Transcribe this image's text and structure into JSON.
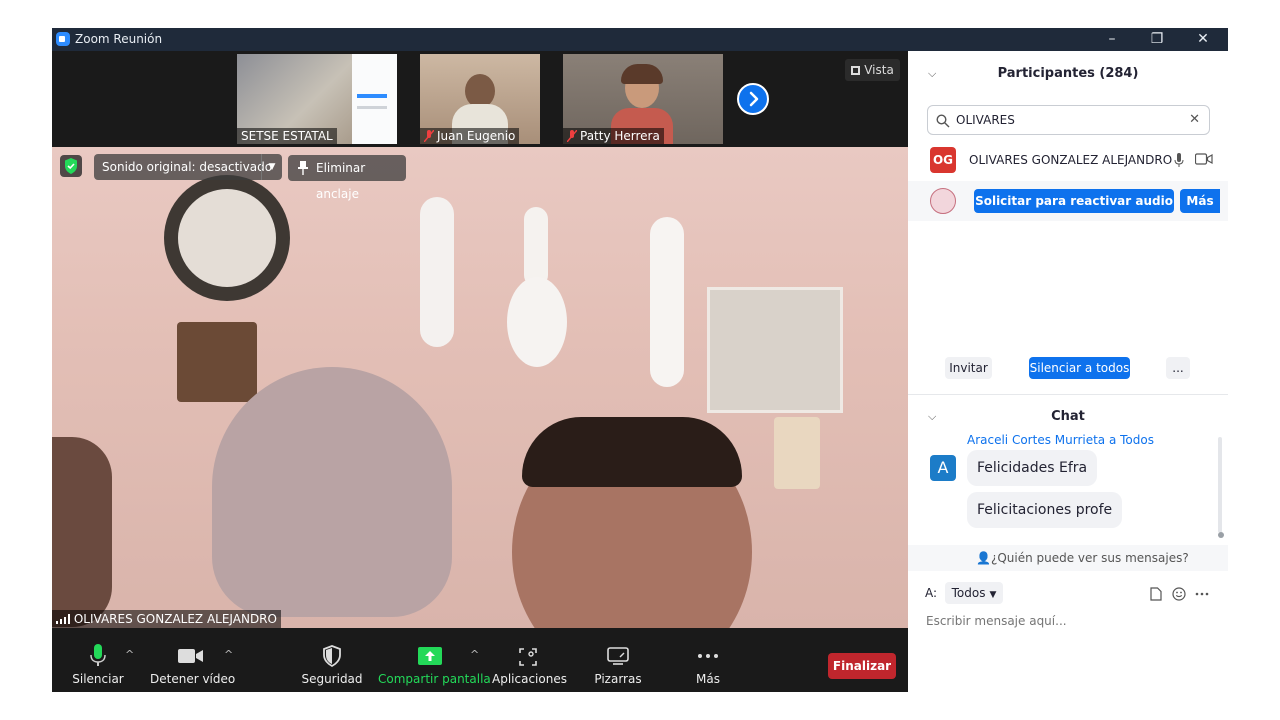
{
  "window": {
    "title": "Zoom Reunión",
    "controls": [
      "–",
      "❐",
      "✕"
    ]
  },
  "thumbnails": [
    {
      "name": "SETSE ESTATAL",
      "muted": false
    },
    {
      "name": "Juan Eugenio",
      "muted": true
    },
    {
      "name": "Patty Herrera",
      "muted": true
    }
  ],
  "view_button": "Vista",
  "main_video": {
    "audio_dropdown": "Sonido original: desactivado",
    "unpin_button": "Eliminar anclaje",
    "speaker_name": "OLIVARES GONZALEZ ALEJANDRO"
  },
  "toolbar": {
    "mute": "Silenciar",
    "stop_video": "Detener vídeo",
    "security": "Seguridad",
    "share_screen": "Compartir pantalla",
    "apps": "Aplicaciones",
    "whiteboards": "Pizarras",
    "more": "Más",
    "end": "Finalizar"
  },
  "participants": {
    "title": "Participantes (284)",
    "search_value": "OLIVARES",
    "list": [
      {
        "initials": "OG",
        "name": "OLIVARES GONZALEZ ALEJANDRO",
        "avatar_color": "#d9362f"
      }
    ],
    "hover_row": {
      "ask_unmute": "Solicitar para reactivar audio",
      "more": "Más"
    },
    "invite": "Invitar",
    "mute_all": "Silenciar a todos",
    "more_dots": "..."
  },
  "chat": {
    "title": "Chat",
    "sender_line": "Araceli Cortes Murrieta a Todos",
    "sender_initial": "A",
    "messages": [
      "Felicidades Efra",
      "Felicitaciones profe"
    ],
    "who_can_see": "¿Quién puede ver sus mensajes?",
    "to_label": "A:",
    "to_value": "Todos",
    "placeholder": "Escribir mensaje aquí..."
  },
  "colors": {
    "accent": "#0e72ed",
    "end": "#c0262d",
    "share": "#23d959",
    "title_bar": "#1f2a3a"
  }
}
